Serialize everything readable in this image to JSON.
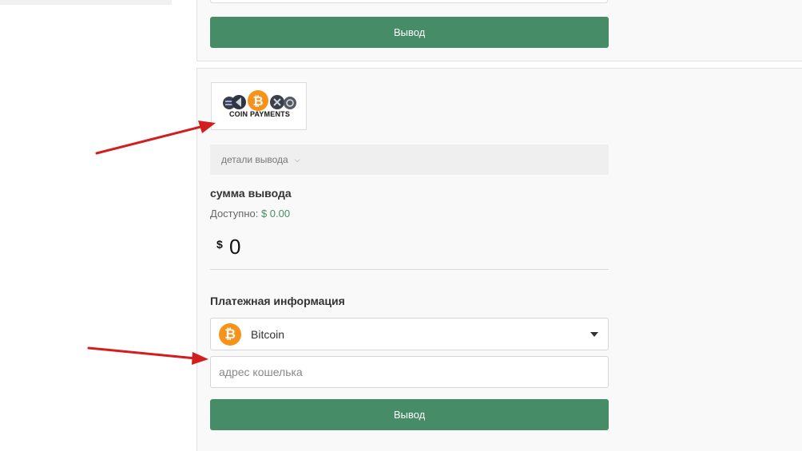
{
  "top_panel": {
    "withdraw_button_label": "Вывод"
  },
  "method": {
    "logo_text": "COIN PAYMENTS",
    "details_toggle_label": "детали вывода",
    "amount_title": "сумма вывода",
    "available_label": "Доступно:",
    "available_value": "$ 0.00",
    "currency_symbol": "$",
    "amount_value": "0",
    "payment_info_title": "Платежная информация",
    "selected_currency": "Bitcoin",
    "currency_icon_glyph": "₿",
    "wallet_placeholder": "адрес кошелька",
    "withdraw_button_label": "Вывод"
  },
  "colors": {
    "accent_green": "#468d67",
    "bitcoin_orange": "#f7931a",
    "annotation_red": "#d21e1e"
  },
  "icons": [
    "coinpayments-logo-icon",
    "chevron-down-icon",
    "bitcoin-icon",
    "caret-down-icon",
    "annotation-arrow-icon"
  ]
}
